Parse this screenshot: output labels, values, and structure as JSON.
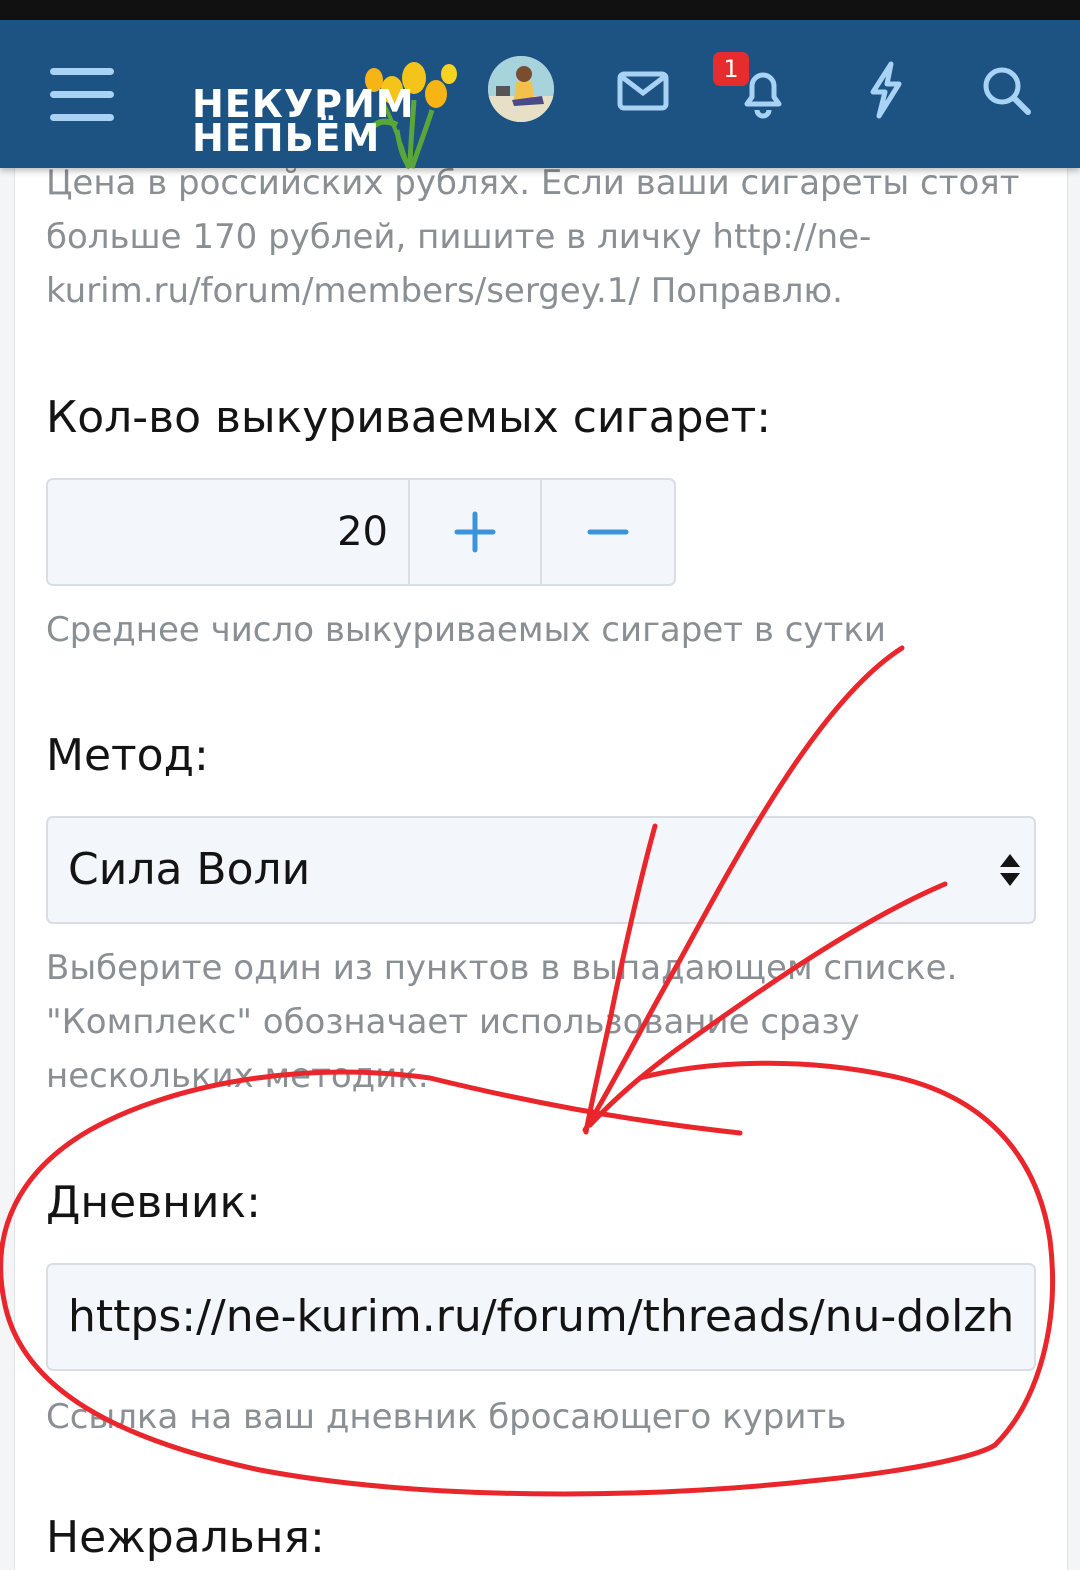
{
  "header": {
    "logo_line1": "НЕКУРИМ",
    "logo_line2": "НЕПЬЁМ",
    "notification_count": "1",
    "icons": [
      "menu-icon",
      "mail-icon",
      "bell-icon",
      "bolt-icon",
      "search-icon"
    ]
  },
  "price_hint": {
    "line1": "Цена в российских рублях. Если ваши сигареты стоят",
    "line2": "больше 170 рублей, пишите в личку http://ne-",
    "line3": "kurim.ru/forum/members/sergey.1/ Поправлю."
  },
  "cigarettes": {
    "label": "Кол-во выкуриваемых сигарет:",
    "value": "20",
    "plus": "+",
    "minus": "−",
    "hint": "Среднее число выкуриваемых сигарет в сутки"
  },
  "method": {
    "label": "Метод:",
    "selected": "Сила Воли",
    "hint_line1": "Выберите один из пунктов в выпадающем списке.",
    "hint_line2": "\"Комплекс\" обозначает использование сразу",
    "hint_line3": "нескольких методик."
  },
  "diary": {
    "label": "Дневник:",
    "value": "https://ne-kurim.ru/forum/threads/nu-dolzhn",
    "hint": "Ссылка на ваш дневник бросающего курить"
  },
  "next_field": {
    "label": "Нежральня:"
  },
  "colors": {
    "header_bg": "#1d5382",
    "accent_blue": "#3b94d9",
    "annotation_red": "#e8262b",
    "badge_red": "#e62d2d"
  }
}
